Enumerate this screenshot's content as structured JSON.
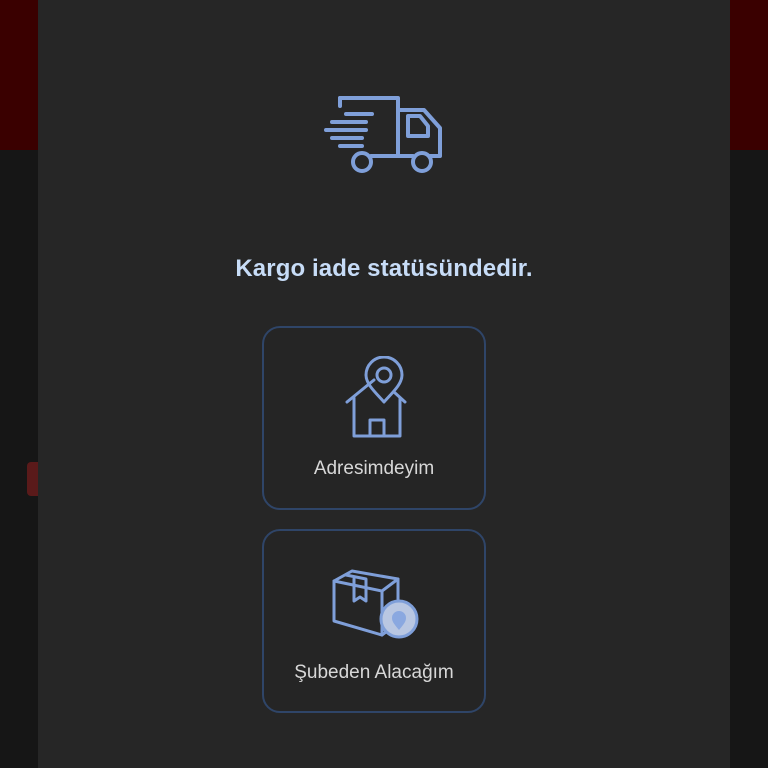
{
  "modal": {
    "title": "Kargo iade statüsündedir.",
    "icon": "delivery-truck-icon"
  },
  "options": [
    {
      "label": "Adresimdeyim",
      "icon": "home-location-icon"
    },
    {
      "label": "Şubeden Alacağım",
      "icon": "package-location-icon"
    }
  ],
  "colors": {
    "accent": "#7f9fd9",
    "title_text": "#c7dcf7",
    "card_border": "#2f4568",
    "modal_background": "#262626",
    "backdrop_red": "#3a0000"
  }
}
